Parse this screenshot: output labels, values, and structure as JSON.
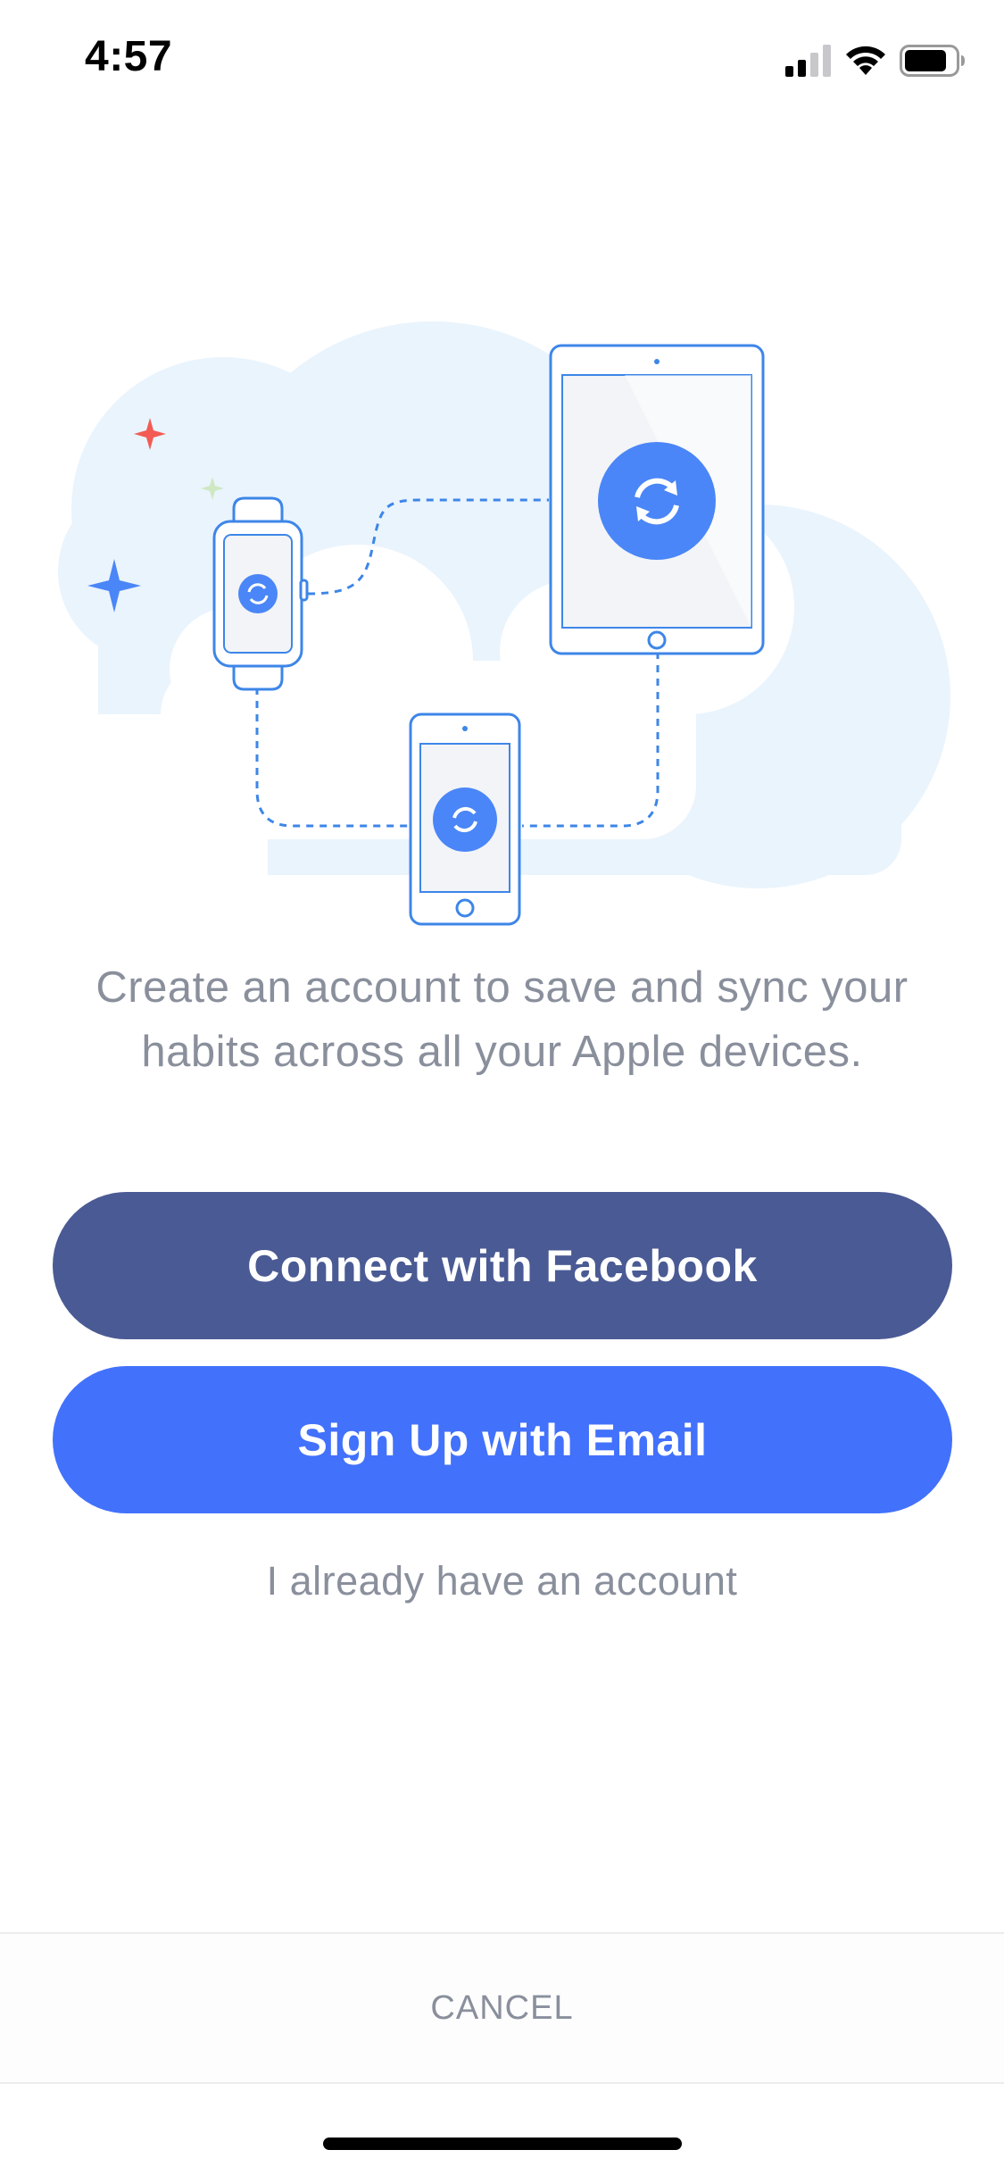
{
  "status_bar": {
    "time": "4:57",
    "icons": [
      "signal-icon",
      "wifi-icon",
      "battery-icon"
    ]
  },
  "illustration": {
    "devices": [
      "apple-watch",
      "ipad",
      "iphone"
    ],
    "sync_icon": "sync-icon",
    "colors": {
      "accent": "#4a86f7",
      "outline": "#3d86e8",
      "cloud": "#eaf4fd",
      "sparkle_red": "#f25c54",
      "sparkle_blue": "#4a86f7",
      "sparkle_green": "#cfe8c4"
    }
  },
  "description": {
    "text": "Create an account to save and sync your habits across all your Apple devices."
  },
  "buttons": {
    "facebook_label": "Connect with Facebook",
    "email_label": "Sign Up with Email",
    "login_label": "I already have an account"
  },
  "footer": {
    "cancel_label": "CANCEL"
  },
  "colors": {
    "facebook_button": "#4a5a94",
    "email_button": "#4271fc",
    "secondary_text": "#8a8f9c"
  }
}
